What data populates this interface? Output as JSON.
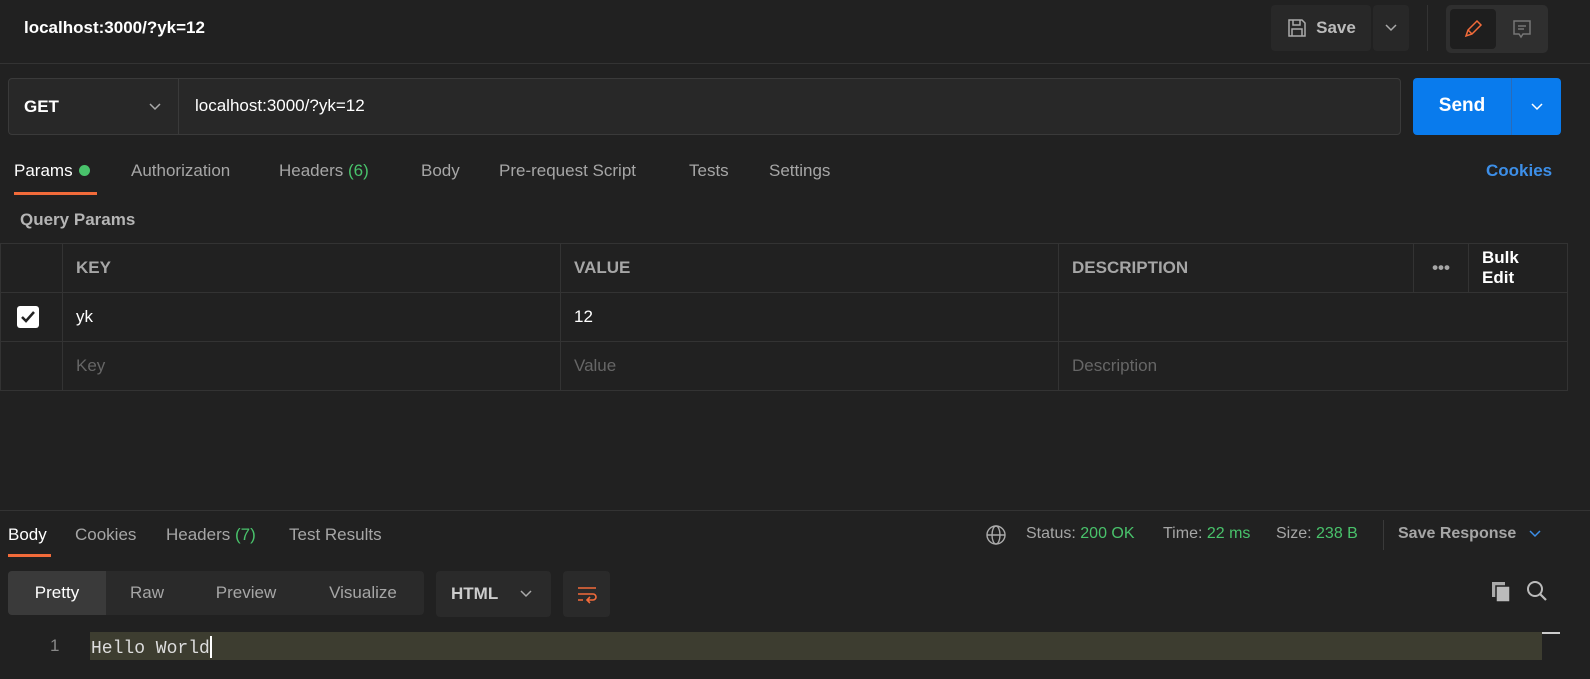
{
  "header": {
    "title": "localhost:3000/?yk=12",
    "save_label": "Save"
  },
  "request": {
    "method": "GET",
    "url": "localhost:3000/?yk=12",
    "send_label": "Send"
  },
  "tabs": {
    "params": "Params",
    "authorization": "Authorization",
    "headers": "Headers",
    "headers_count": "(6)",
    "body": "Body",
    "prerequest": "Pre-request Script",
    "tests": "Tests",
    "settings": "Settings",
    "cookies": "Cookies"
  },
  "query_params": {
    "title": "Query Params",
    "columns": {
      "key": "KEY",
      "value": "VALUE",
      "description": "DESCRIPTION",
      "more": "•••",
      "bulk_edit": "Bulk Edit"
    },
    "rows": [
      {
        "checked": true,
        "key": "yk",
        "value": "12",
        "description": ""
      }
    ],
    "placeholders": {
      "key": "Key",
      "value": "Value",
      "description": "Description"
    }
  },
  "response": {
    "tabs": {
      "body": "Body",
      "cookies": "Cookies",
      "headers": "Headers",
      "headers_count": "(7)",
      "test_results": "Test Results"
    },
    "status_label": "Status:",
    "status": "200 OK",
    "time_label": "Time:",
    "time": "22 ms",
    "size_label": "Size:",
    "size": "238 B",
    "save_response": "Save Response",
    "views": [
      "Pretty",
      "Raw",
      "Preview",
      "Visualize"
    ],
    "format": "HTML",
    "lines": [
      {
        "num": "1",
        "text": "Hello World"
      }
    ]
  },
  "colors": {
    "accent": "#f26b3a",
    "send": "#097bed",
    "success": "#49c26b",
    "link": "#3d8fe8"
  }
}
